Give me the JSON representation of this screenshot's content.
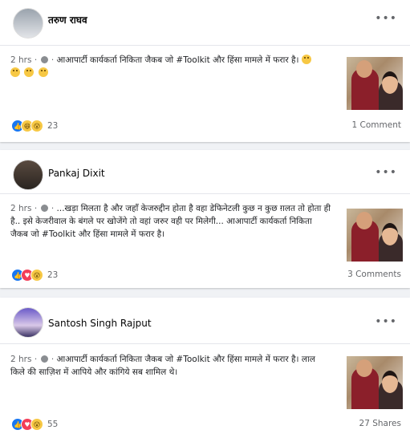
{
  "posts": [
    {
      "author": "तरुण राघव",
      "more": "•••",
      "time": "2 hrs",
      "sep": "·",
      "text": "आआपार्टी कार्यकर्ता निकिता जैकब जो #Toolkit और हिंसा मामले में फरार है।",
      "reaction_count": "23",
      "right_stat": "1 Comment",
      "reactions": [
        "like-icon",
        "haha-icon",
        "wow-icon"
      ]
    },
    {
      "author": "Pankaj Dixit",
      "more": "•••",
      "time": "2 hrs",
      "sep": "·",
      "text": "...खड़ा मिलता है और जहाँ केजरुद्दीन होता है वहा डेफिनेटली कुछ न कुछ ग़लत तो होता ही है.. इसे केजरीवाल के बंगले पर खोजेंगे तो वहां जरुर वही पर मिलेगी... आआपार्टी कार्यकर्ता निकिता जैकब जो #Toolkit और हिंसा मामले में फरार है।",
      "reaction_count": "23",
      "right_stat": "3 Comments",
      "reactions": [
        "like-icon",
        "love-icon",
        "wow-icon"
      ]
    },
    {
      "author": "Santosh Singh Rajput",
      "more": "•••",
      "time": "2 hrs",
      "sep": "·",
      "text": "आआपार्टी कार्यकर्ता निकिता जैकब जो #Toolkit और हिंसा मामले में फरार है। लाल किले की साज़िश में आपिये और कांगिये सब शामिल थे।",
      "reaction_count": "55",
      "right_stat": "27 Shares",
      "reactions": [
        "like-icon",
        "love-icon",
        "wow-icon"
      ]
    }
  ],
  "colors": {
    "background": "#f0f2f5",
    "card": "#ffffff",
    "meta": "#65676b",
    "like": "#1877f2",
    "love": "#f33e58",
    "emoji": "#f7c844"
  }
}
